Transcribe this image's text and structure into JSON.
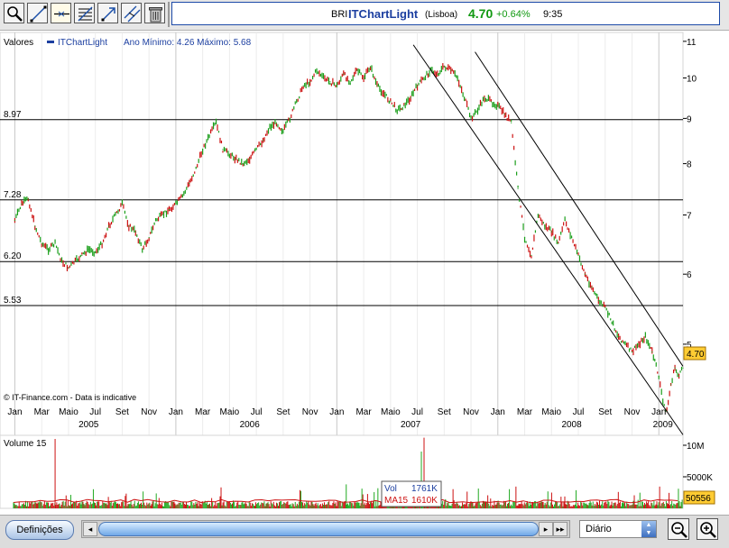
{
  "toolbar": {
    "icons": [
      "zoom-icon",
      "draw-line-icon",
      "horizontal-line-icon",
      "fibonacci-icon",
      "trend-arrow-icon",
      "parallel-channel-icon",
      "trash-icon"
    ]
  },
  "ticker": {
    "symbol": "BRI",
    "name": "ITChartLight",
    "market": "(Lisboa)",
    "price": "4.70",
    "change": "+0.64%",
    "time": "9:35",
    "change_color": "#119911",
    "name_color": "#1c3fa0"
  },
  "chart_data": [
    {
      "type": "line",
      "legend": {
        "label": "Valores",
        "series_name": "ITChartLight",
        "range_text": "Ano Mínimo: 4.26 Máximo: 5.68"
      },
      "x_tick_labels": [
        "Jan",
        "Mar",
        "Maio",
        "Jul",
        "Set",
        "Nov",
        "Jan",
        "Mar",
        "Maio",
        "Jul",
        "Set",
        "Nov",
        "Jan",
        "Mar",
        "Maio",
        "Jul",
        "Set",
        "Nov",
        "Jan",
        "Mar",
        "Maio",
        "Jul",
        "Set",
        "Nov",
        "Jan"
      ],
      "x_tick_months": [
        0,
        2,
        4,
        6,
        8,
        10,
        12,
        14,
        16,
        18,
        20,
        22,
        24,
        26,
        28,
        30,
        32,
        34,
        36,
        38,
        40,
        42,
        44,
        46,
        48
      ],
      "year_labels": [
        {
          "label": "2005",
          "month": 5.5
        },
        {
          "label": "2006",
          "month": 17.5
        },
        {
          "label": "2007",
          "month": 29.5
        },
        {
          "label": "2008",
          "month": 41.5
        },
        {
          "label": "2009",
          "month": 48.3
        }
      ],
      "y_ticks": [
        5,
        6,
        7,
        8,
        9,
        10,
        11
      ],
      "y_scale": "log",
      "ylim": [
        4.0,
        11.1
      ],
      "xlim_months": [
        -0.3,
        49.8
      ],
      "horizontal_lines": [
        {
          "label": "8.97",
          "value": 8.97
        },
        {
          "label": "7.28",
          "value": 7.28
        },
        {
          "label": "6.20",
          "value": 6.2
        },
        {
          "label": "5.53",
          "value": 5.53
        }
      ],
      "series": [
        {
          "name": "ITChartLight",
          "color": "#1a9e1a",
          "down_color": "#cc1111",
          "x_months": [
            0,
            0.5,
            1,
            1.5,
            2,
            2.5,
            3,
            3.5,
            4,
            4.5,
            5,
            5.5,
            6,
            6.5,
            7,
            7.5,
            8,
            8.5,
            9,
            9.5,
            10,
            10.5,
            11,
            11.5,
            12,
            12.5,
            13,
            13.5,
            14,
            14.5,
            15,
            15.5,
            16,
            16.5,
            17,
            17.5,
            18,
            18.5,
            19,
            19.5,
            20,
            20.5,
            21,
            21.5,
            22,
            22.5,
            23,
            23.5,
            24,
            24.5,
            25,
            25.5,
            26,
            26.5,
            27,
            27.5,
            28,
            28.5,
            29,
            29.5,
            30,
            30.5,
            31,
            31.5,
            32,
            32.5,
            33,
            33.5,
            34,
            34.5,
            35,
            35.5,
            36,
            36.5,
            37,
            37.5,
            38,
            38.5,
            39,
            39.5,
            40,
            40.5,
            41,
            41.5,
            42,
            42.5,
            43,
            43.5,
            44,
            44.5,
            45,
            45.5,
            46,
            46.5,
            47,
            47.5,
            48,
            48.3,
            48.6,
            48.9,
            49.2,
            49.5,
            49.8
          ],
          "values": [
            6.9,
            7.2,
            7.3,
            6.8,
            6.5,
            6.4,
            6.5,
            6.2,
            6.1,
            6.2,
            6.3,
            6.4,
            6.35,
            6.5,
            6.8,
            7.0,
            7.2,
            6.8,
            6.7,
            6.4,
            6.6,
            6.9,
            7.0,
            7.1,
            7.2,
            7.35,
            7.6,
            7.9,
            8.3,
            8.6,
            8.9,
            8.3,
            8.2,
            8.1,
            8.0,
            8.1,
            8.3,
            8.5,
            8.8,
            8.9,
            8.7,
            9.0,
            9.4,
            9.8,
            9.9,
            10.2,
            10.0,
            9.9,
            9.8,
            10.1,
            9.9,
            10.2,
            10.0,
            10.3,
            9.8,
            9.6,
            9.4,
            9.2,
            9.3,
            9.5,
            9.8,
            10.0,
            10.2,
            10.1,
            10.3,
            10.2,
            10.0,
            9.5,
            9.0,
            9.2,
            9.5,
            9.4,
            9.3,
            9.1,
            8.9,
            7.5,
            6.6,
            6.3,
            7.0,
            6.8,
            6.7,
            6.5,
            6.9,
            6.6,
            6.3,
            6.0,
            5.8,
            5.6,
            5.5,
            5.3,
            5.1,
            5.0,
            4.9,
            5.0,
            5.1,
            4.9,
            4.6,
            4.3,
            4.2,
            4.5,
            4.7,
            4.6,
            4.7
          ]
        },
        {
          "name": "channel-upper",
          "color": "#000000",
          "x_months": [
            34.3,
            49.8
          ],
          "values": [
            10.7,
            4.72
          ]
        },
        {
          "name": "channel-lower",
          "color": "#000000",
          "x_months": [
            29.7,
            49.8
          ],
          "values": [
            10.9,
            3.95
          ]
        }
      ],
      "annotations": [
        "© IT-Finance.com - Data is indicative"
      ],
      "last_price_label": "4.70"
    },
    {
      "type": "bar",
      "title": "Volume 15",
      "y_tick_labels": [
        "10M",
        "5000K"
      ],
      "y_ticks": [
        10000000,
        5000000
      ],
      "ylim": [
        0,
        11000000
      ],
      "series": [
        {
          "name": "Vol",
          "color": "#22aa22",
          "label_value": "1761K"
        },
        {
          "name": "MA15",
          "color": "#cc1111",
          "label_value": "1610K"
        }
      ],
      "spikes": [
        {
          "month": 3.0,
          "value": 11000000
        },
        {
          "month": 24.7,
          "value": 3800000
        },
        {
          "month": 30.5,
          "value": 11200000
        },
        {
          "month": 30.3,
          "value": 9000000
        }
      ],
      "last_value_label": "50556"
    }
  ],
  "bottom": {
    "definicoes_label": "Definições",
    "period_value": "Diário",
    "scroll_left": "◂",
    "scroll_right1": "▸",
    "scroll_right2": "▸▸"
  }
}
